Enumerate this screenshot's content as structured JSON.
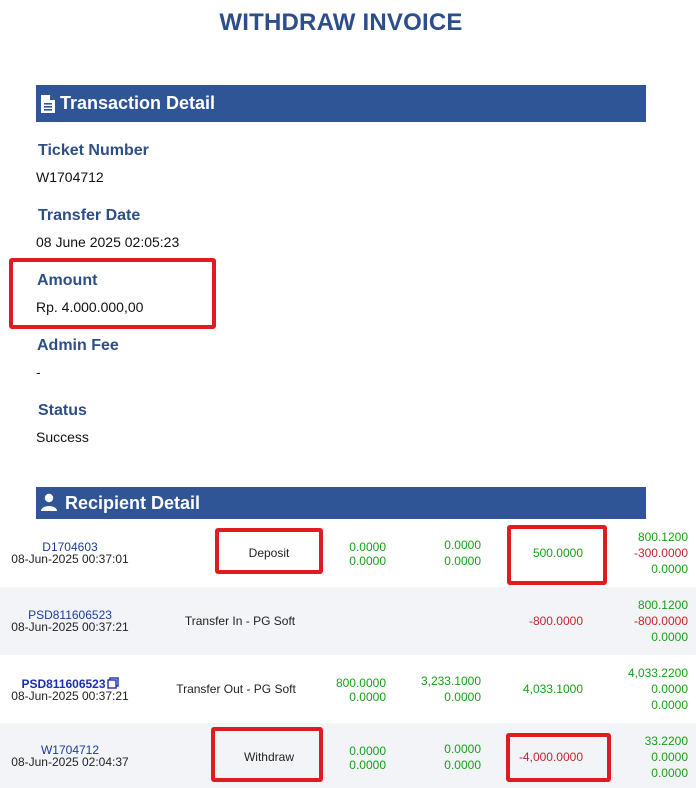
{
  "page_title": "WITHDRAW INVOICE",
  "transaction_section": {
    "title": "Transaction Detail",
    "icon": "document-icon",
    "fields": [
      {
        "label": "Ticket Number",
        "value": "W1704712"
      },
      {
        "label": "Transfer Date",
        "value": "08 June 2025 02:05:23"
      },
      {
        "label": "Amount",
        "value": "Rp. 4.000.000,00"
      },
      {
        "label": "Admin Fee",
        "value": "-"
      },
      {
        "label": "Status",
        "value": "Success"
      }
    ]
  },
  "recipient_section": {
    "title": "Recipient Detail",
    "icon": "user-icon"
  },
  "rows": [
    {
      "ticket": "D1704603",
      "date": "08-Jun-2025 00:37:01",
      "description": "Deposit",
      "col1": [
        "0.0000",
        "0.0000"
      ],
      "col2": [
        "0.0000",
        "0.0000"
      ],
      "amount": "500.0000",
      "balances": [
        "800.1200",
        "-300.0000",
        "0.0000"
      ]
    },
    {
      "ticket": "PSD811606523",
      "date": "08-Jun-2025 00:37:21",
      "description": "Transfer In - PG Soft",
      "col1": [],
      "col2": [],
      "amount": "-800.0000",
      "balances": [
        "800.1200",
        "-800.0000",
        "0.0000"
      ]
    },
    {
      "ticket": "PSD811606523",
      "date": "08-Jun-2025 00:37:21",
      "description": "Transfer Out - PG Soft",
      "col1": [
        "800.0000",
        "0.0000"
      ],
      "col2": [
        "3,233.1000",
        "0.0000"
      ],
      "amount": "4,033.1000",
      "balances": [
        "4,033.2200",
        "0.0000",
        "0.0000"
      ]
    },
    {
      "ticket": "W1704712",
      "date": "08-Jun-2025 02:04:37",
      "description": "Withdraw",
      "col1": [
        "0.0000",
        "0.0000"
      ],
      "col2": [
        "0.0000",
        "0.0000"
      ],
      "amount": "-4,000.0000",
      "balances": [
        "33.2200",
        "0.0000",
        "0.0000"
      ]
    }
  ],
  "colors": {
    "header_blue": "#2f5597",
    "label_blue": "#2d4f86",
    "highlight_red": "#e11b22",
    "positive_green": "#1a9e1a",
    "negative_red": "#c1272d"
  }
}
